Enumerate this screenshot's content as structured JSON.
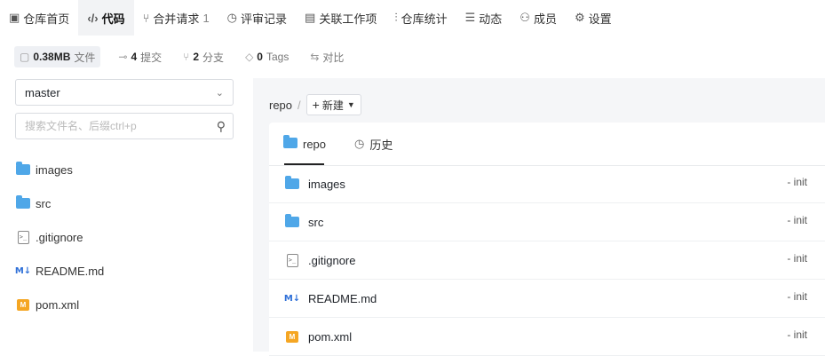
{
  "nav": [
    {
      "label": "仓库首页",
      "icon": "repo-home-icon",
      "glyph": "▣",
      "active": false
    },
    {
      "label": "代码",
      "icon": "code-icon",
      "glyph": "‹/›",
      "active": true
    },
    {
      "label": "合并请求",
      "icon": "merge-request-icon",
      "glyph": "⑂",
      "count": "1",
      "active": false
    },
    {
      "label": "评审记录",
      "icon": "review-icon",
      "glyph": "◷",
      "active": false
    },
    {
      "label": "关联工作项",
      "icon": "work-item-icon",
      "glyph": "▤",
      "active": false
    },
    {
      "label": "仓库统计",
      "icon": "stats-icon",
      "glyph": "⫶",
      "active": false
    },
    {
      "label": "动态",
      "icon": "activity-icon",
      "glyph": "☰",
      "active": false
    },
    {
      "label": "成员",
      "icon": "members-icon",
      "glyph": "⚇",
      "active": false
    },
    {
      "label": "设置",
      "icon": "settings-icon",
      "glyph": "⚙",
      "active": false
    }
  ],
  "stats": {
    "size": {
      "value": "0.38MB",
      "label": "文件",
      "icon": "file-size-icon"
    },
    "commits": {
      "value": "4",
      "label": "提交",
      "icon": "commit-icon"
    },
    "branches": {
      "value": "2",
      "label": "分支",
      "icon": "branch-icon"
    },
    "tags": {
      "value": "0",
      "label": "Tags",
      "icon": "tag-icon"
    },
    "compare": {
      "label": "对比",
      "icon": "compare-icon"
    }
  },
  "branch_select": {
    "value": "master",
    "icon": "chevron-down-icon"
  },
  "search": {
    "placeholder": "搜索文件名、后缀ctrl+p",
    "icon": "search-icon"
  },
  "tree": [
    {
      "name": "images",
      "type": "folder"
    },
    {
      "name": "src",
      "type": "folder"
    },
    {
      "name": ".gitignore",
      "type": "file"
    },
    {
      "name": "README.md",
      "type": "markdown"
    },
    {
      "name": "pom.xml",
      "type": "xml"
    }
  ],
  "breadcrumb": {
    "root": "repo",
    "sep": "/",
    "new_label": "新建"
  },
  "tabs": [
    {
      "label": "repo",
      "icon": "folder-icon"
    },
    {
      "label": "历史",
      "icon": "history-icon"
    }
  ],
  "files": [
    {
      "name": "images",
      "type": "folder",
      "commit": "- init"
    },
    {
      "name": "src",
      "type": "folder",
      "commit": "- init"
    },
    {
      "name": ".gitignore",
      "type": "file",
      "commit": "- init"
    },
    {
      "name": "README.md",
      "type": "markdown",
      "commit": "- init"
    },
    {
      "name": "pom.xml",
      "type": "xml",
      "commit": "- init"
    }
  ],
  "colors": {
    "folder": "#4fa7e8",
    "markdown": "#2f70d8",
    "xml": "#f5a623",
    "panel_bg": "#f5f6f8"
  }
}
